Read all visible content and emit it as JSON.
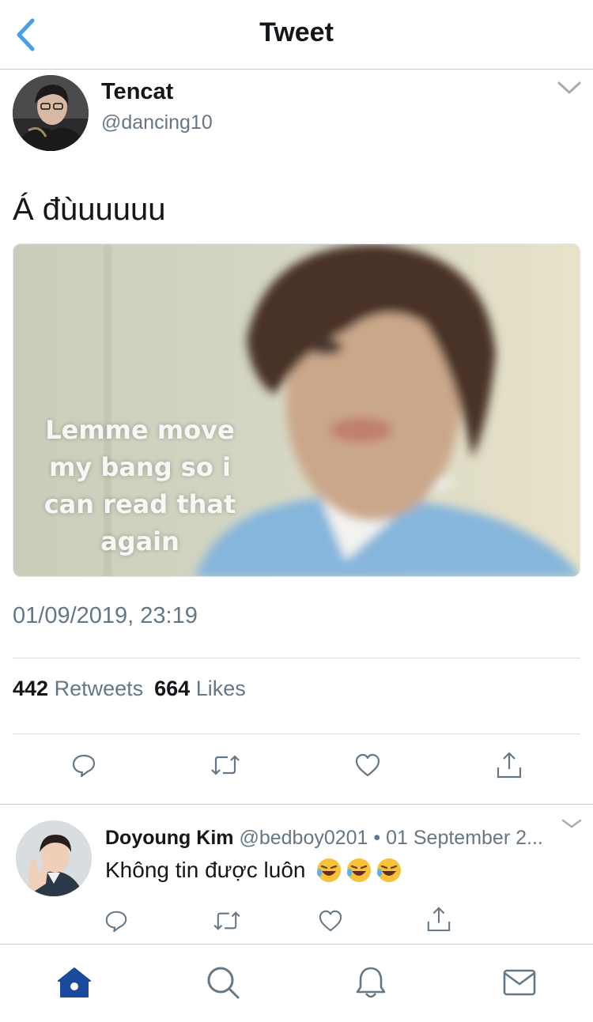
{
  "header": {
    "title": "Tweet",
    "back_icon": "chevron-left-icon",
    "accent_color": "#4a9de8"
  },
  "tweet": {
    "author_name": "Tencat",
    "author_handle": "@dancing10",
    "text": "Á đùuuuuu",
    "media_caption": [
      "Lemme move",
      "my bang so i",
      "can read that",
      "again"
    ],
    "timestamp": "01/09/2019, 23:19",
    "retweets_count": "442",
    "retweets_label": "Retweets",
    "likes_count": "664",
    "likes_label": "Likes",
    "actions": [
      "reply-icon",
      "retweet-icon",
      "like-icon",
      "share-icon"
    ]
  },
  "reply": {
    "author_name": "Doyoung Kim",
    "meta": "@bedboy0201 • 01 September 2...",
    "text": "Không tin được luôn",
    "emoji": "rolling-on-floor-laughing-emoji"
  },
  "tabbar": {
    "items": [
      "home-icon",
      "search-icon",
      "notifications-icon",
      "messages-icon"
    ],
    "active_color": "#1b4a9c",
    "inactive_color": "#657786"
  }
}
